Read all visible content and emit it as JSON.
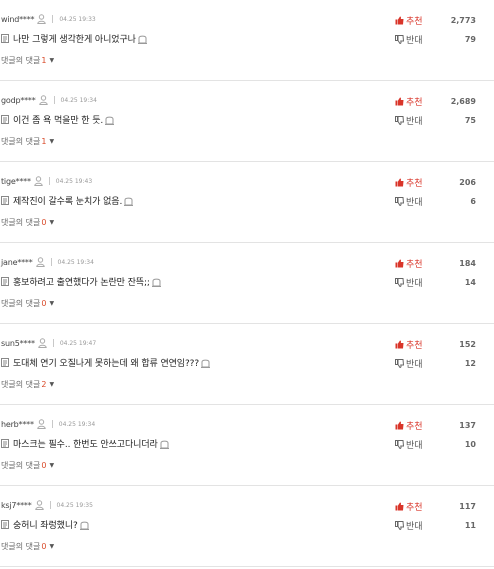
{
  "labels": {
    "recommend": "추천",
    "oppose": "반대",
    "reply": "댓글의 댓글"
  },
  "colors": {
    "accent_red": "#d9352a",
    "reply_count": "#d94b2b",
    "divider": "#e3e3e3"
  },
  "icons": {
    "user": "user-icon",
    "doc": "document-icon",
    "report": "report-icon",
    "thumb_up": "thumb-up-icon",
    "thumb_down": "thumb-down-icon",
    "caret": "caret-down-icon"
  },
  "comments": [
    {
      "user": "wind****",
      "date": "04.25 19:33",
      "text": "나만 그렇게 생각한게 아니었구나",
      "replies": "1",
      "likes": "2,773",
      "dislikes": "79"
    },
    {
      "user": "godp****",
      "date": "04.25 19:34",
      "text": "이건 좀 욕 먹을만 한 듯.",
      "replies": "1",
      "likes": "2,689",
      "dislikes": "75"
    },
    {
      "user": "tige****",
      "date": "04.25 19:43",
      "text": "제작진이 갈수록 눈치가 없음.",
      "replies": "0",
      "likes": "206",
      "dislikes": "6"
    },
    {
      "user": "jane****",
      "date": "04.25 19:34",
      "text": "홍보하려고 출연했다가 논란만 잔뜩;;",
      "replies": "0",
      "likes": "184",
      "dislikes": "14"
    },
    {
      "user": "sun5****",
      "date": "04.25 19:47",
      "text": "도대체 연기 오질나게 못하는데 왜 합류 연연임???",
      "replies": "2",
      "likes": "152",
      "dislikes": "12"
    },
    {
      "user": "herb****",
      "date": "04.25 19:34",
      "text": "마스크는 필수.. 한번도 안쓰고다니더라",
      "replies": "0",
      "likes": "137",
      "dislikes": "10"
    },
    {
      "user": "ksj7****",
      "date": "04.25 19:35",
      "text": "숭허니 좌렁했니?",
      "replies": "0",
      "likes": "117",
      "dislikes": "11"
    }
  ]
}
